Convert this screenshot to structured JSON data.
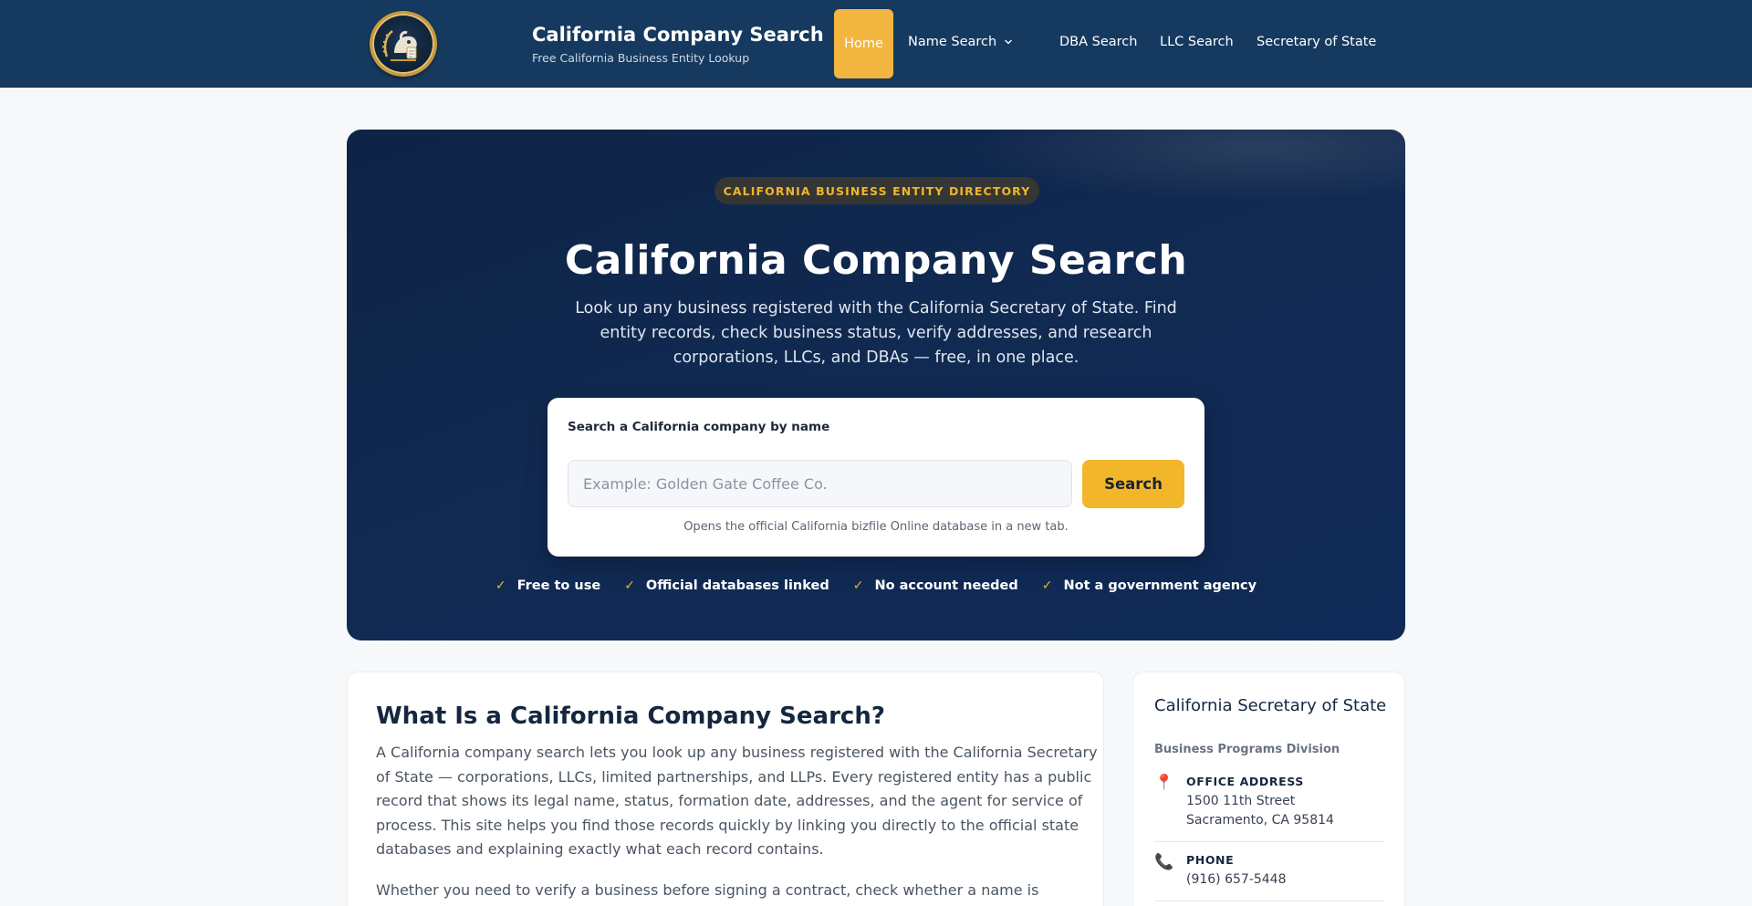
{
  "header": {
    "brand_title": "California Company Search",
    "brand_subtitle": "Free California Business Entity Lookup",
    "nav": {
      "home": "Home",
      "name_search": "Name Search",
      "dba_search": "DBA Search",
      "llc_search": "LLC Search",
      "secretary_of_state": "Secretary of State"
    }
  },
  "hero": {
    "badge": "CALIFORNIA BUSINESS ENTITY DIRECTORY",
    "title": "California Company Search",
    "description": "Look up any business registered with the California Secretary of State. Find entity records, check business status, verify addresses, and research corporations, LLCs, and DBAs — free, in one place.",
    "search": {
      "label": "Search a California company by name",
      "placeholder": "Example: Golden Gate Coffee Co.",
      "value": "",
      "button": "Search",
      "note": "Opens the official California bizfile Online database in a new tab."
    },
    "features": [
      {
        "check": "✓",
        "text": "Free to use"
      },
      {
        "check": "✓",
        "text": "Official databases linked"
      },
      {
        "check": "✓",
        "text": "No account needed"
      },
      {
        "check": "✓",
        "text": "Not a government agency"
      }
    ]
  },
  "main": {
    "title": "What Is a California Company Search?",
    "paragraphs": [
      "A California company search lets you look up any business registered with the California Secretary of State — corporations, LLCs, limited partnerships, and LLPs. Every registered entity has a public record that shows its legal name, status, formation date, addresses, and the agent for service of process. This site helps you find those records quickly by linking you directly to the official state databases and explaining exactly what each record contains.",
      "Whether you need to verify a business before signing a contract, check whether a name is available,"
    ]
  },
  "sidebar": {
    "title": "California Secretary of State",
    "subtitle": "Business Programs Division",
    "address_label": "OFFICE ADDRESS",
    "address_line1": "1500 11th Street",
    "address_line2": "Sacramento, CA 95814",
    "phone_label": "PHONE",
    "phone_value": "(916) 657-5448"
  },
  "colors": {
    "header_bg": "#163a5f",
    "accent": "#f2b62b",
    "hero_bg": "#0f2a52"
  },
  "icons": {
    "logo": "golden-bear-emblem",
    "nav_chevron": "chevron-down-icon",
    "address": "map-pin-icon",
    "phone": "phone-icon"
  }
}
